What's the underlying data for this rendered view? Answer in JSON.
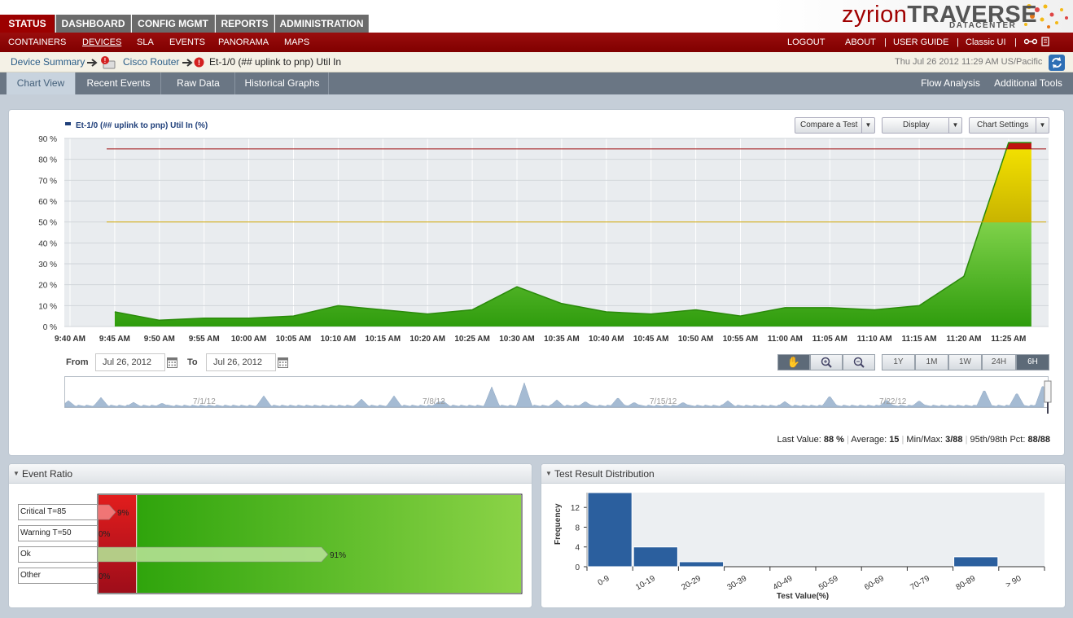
{
  "main_tabs": [
    {
      "label": "STATUS",
      "active": true
    },
    {
      "label": "DASHBOARD",
      "active": false
    },
    {
      "label": "CONFIG MGMT",
      "active": false
    },
    {
      "label": "REPORTS",
      "active": false
    },
    {
      "label": "ADMINISTRATION",
      "active": false
    }
  ],
  "logo": {
    "prefix": "zyrion",
    "name": "TRAVERSE",
    "sub": "DATACENTER"
  },
  "sub_nav": [
    "CONTAINERS",
    "DEVICES",
    "SLA",
    "EVENTS",
    "PANORAMA",
    "MAPS"
  ],
  "sub_nav_active": "DEVICES",
  "user_links": {
    "logout": "LOGOUT",
    "about": "ABOUT",
    "user_guide": "USER GUIDE",
    "classic_ui": "Classic UI",
    "sep": "|"
  },
  "breadcrumb": {
    "device_summary": "Device Summary",
    "device": "Cisco Router",
    "test": "Et-1/0 (## uplink to pnp) Util In"
  },
  "datetime": "Thu Jul 26 2012 11:29 AM US/Pacific",
  "view_tabs": [
    "Chart View",
    "Recent Events",
    "Raw Data",
    "Historical Graphs"
  ],
  "right_tabs": [
    "Flow Analysis",
    "Additional Tools"
  ],
  "chart": {
    "legend": "Et-1/0 (## uplink to pnp) Util In (%)",
    "buttons": {
      "compare": "Compare a Test",
      "display": "Display",
      "settings": "Chart Settings"
    }
  },
  "chart_data": [
    {
      "type": "area",
      "title": "Et-1/0 (## uplink to pnp) Util In (%)",
      "x": [
        "9:45 AM",
        "9:50 AM",
        "9:55 AM",
        "10:00 AM",
        "10:05 AM",
        "10:10 AM",
        "10:15 AM",
        "10:20 AM",
        "10:25 AM",
        "10:30 AM",
        "10:35 AM",
        "10:40 AM",
        "10:45 AM",
        "10:50 AM",
        "10:55 AM",
        "11:00 AM",
        "11:05 AM",
        "11:10 AM",
        "11:15 AM",
        "11:20 AM",
        "11:25 AM",
        "11:27 AM"
      ],
      "values": [
        7,
        3,
        4,
        4,
        5,
        10,
        8,
        6,
        8,
        19,
        11,
        7,
        6,
        8,
        5,
        9,
        9,
        8,
        10,
        24,
        88,
        88
      ],
      "x_ticks": [
        "9:40 AM",
        "9:45 AM",
        "9:50 AM",
        "9:55 AM",
        "10:00 AM",
        "10:05 AM",
        "10:10 AM",
        "10:15 AM",
        "10:20 AM",
        "10:25 AM",
        "10:30 AM",
        "10:35 AM",
        "10:40 AM",
        "10:45 AM",
        "10:50 AM",
        "10:55 AM",
        "11:00 AM",
        "11:05 AM",
        "11:10 AM",
        "11:15 AM",
        "11:20 AM",
        "11:25 AM"
      ],
      "y_ticks": [
        "0 %",
        "10 %",
        "20 %",
        "30 %",
        "40 %",
        "50 %",
        "60 %",
        "70 %",
        "80 %",
        "90 %"
      ],
      "ylim": [
        0,
        90
      ],
      "thresholds": [
        {
          "name": "Critical",
          "value": 85,
          "color": "#a01010"
        },
        {
          "name": "Warning",
          "value": 50,
          "color": "#d4a800"
        }
      ],
      "grid": true
    },
    {
      "type": "bar",
      "title": "Event Ratio",
      "categories": [
        "Critical T=85",
        "Warning T=50",
        "Ok",
        "Other"
      ],
      "values": [
        9,
        0,
        91,
        0
      ],
      "value_labels": [
        "9%",
        "0%",
        "91%",
        "0%"
      ]
    },
    {
      "type": "bar",
      "title": "Test Result Distribution",
      "categories": [
        "0-9",
        "10-19",
        "20-29",
        "30-39",
        "40-49",
        "50-59",
        "60-69",
        "70-79",
        "80-89",
        "> 90"
      ],
      "values": [
        15,
        4,
        1,
        0,
        0,
        0,
        0,
        0,
        2,
        0
      ],
      "xlabel": "Test Value(%)",
      "ylabel": "Frequency",
      "y_ticks": [
        "0",
        "4",
        "8",
        "12"
      ],
      "ylim": [
        0,
        15
      ]
    }
  ],
  "range": {
    "from_label": "From",
    "from": "Jul 26, 2012",
    "to_label": "To",
    "to": "Jul 26, 2012"
  },
  "range_buttons": [
    "1Y",
    "1M",
    "1W",
    "24H",
    "6H"
  ],
  "range_active": "6H",
  "navigator_dates": [
    "7/1/12",
    "7/8/12",
    "7/15/12",
    "7/22/12"
  ],
  "stats": {
    "last_label": "Last Value:",
    "last": "88 %",
    "avg_label": "Average:",
    "avg": "15",
    "minmax_label": "Min/Max:",
    "minmax": "3/88",
    "pct_label": "95th/98th Pct:",
    "pct": "88/88"
  },
  "panels": {
    "event_ratio": "Event Ratio",
    "distribution": "Test Result Distribution"
  },
  "colors": {
    "brand": "#9c0000",
    "area_green": "#4cb81a",
    "warning": "#e8d000",
    "critical": "#c01010",
    "hist_bar": "#2b5f9e"
  }
}
